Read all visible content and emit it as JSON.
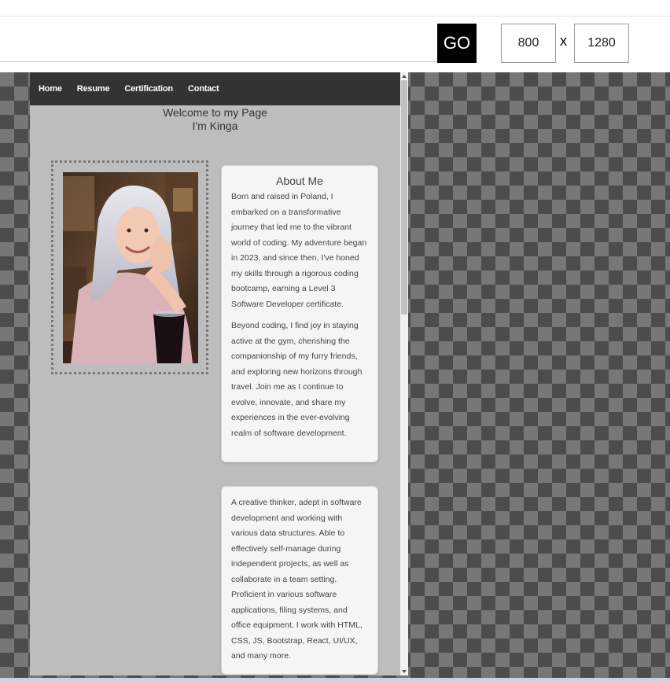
{
  "toolbar": {
    "go_label": "GO",
    "width_value": "800",
    "separator": "x",
    "height_value": "1280"
  },
  "site": {
    "nav": [
      "Home",
      "Resume",
      "Certification",
      "Contact"
    ],
    "welcome_line1": "Welcome to my Page",
    "welcome_line2": "I'm Kinga",
    "about": {
      "title": "About Me",
      "paragraph1": "Born and raised in Poland, I embarked on a transformative journey that led me to the vibrant world of coding. My adventure began in 2023, and since then, I've honed my skills through a rigorous coding bootcamp, earning a Level 3 Software Developer certificate.",
      "paragraph2": "Beyond coding, I find joy in staying active at the gym, cherishing the companionship of my furry friends, and exploring new horizons through travel. Join me as I continue to evolve, innovate, and share my experiences in the ever-evolving realm of software development."
    },
    "skills": {
      "paragraph": "A creative thinker, adept in software development and working with various data structures. Able to effectively self-manage during independent projects, as well as collaborate in a team setting. Proficient in various software applications, filing systems, and office equipment. I work with HTML, CSS, JS, Bootstrap, React, UI/UX, and many more."
    }
  },
  "colors": {
    "navbar": "#333333",
    "page_background": "#bdbdbd",
    "card_background": "#f5f5f5",
    "go_button": "#000000"
  }
}
